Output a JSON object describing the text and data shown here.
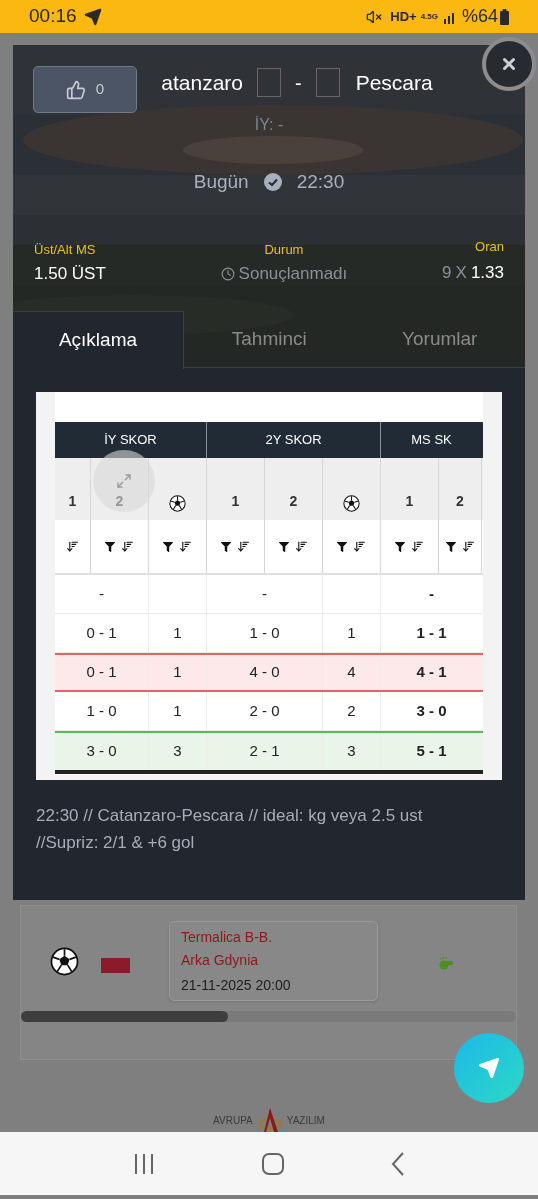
{
  "status_bar": {
    "time": "00:16",
    "network_badge": "HD+",
    "network_type": "4.5G",
    "battery": "%64"
  },
  "match": {
    "like_count": "0",
    "home_team": "atanzaro",
    "separator": "-",
    "away_team": "Pescara",
    "half_time": "İY: -",
    "day": "Bugün",
    "time": "22:30"
  },
  "market": {
    "label": "Üst/Alt MS",
    "value": "1.50 ÜST"
  },
  "status": {
    "label": "Durum",
    "value": "Sonuçlanmadı"
  },
  "odds": {
    "label": "Oran",
    "count": "9",
    "separator": "X",
    "value": "1.33"
  },
  "tabs": [
    {
      "label": "Açıklama",
      "selected": true
    },
    {
      "label": "Tahminci",
      "selected": false
    },
    {
      "label": "Yorumlar",
      "selected": false
    }
  ],
  "score_table": {
    "groups": [
      "İY SKOR",
      "2Y SKOR",
      "MS SK"
    ],
    "subheaders": [
      {
        "kind": "number",
        "label": "1"
      },
      {
        "kind": "number",
        "label": "2"
      },
      {
        "kind": "ball"
      },
      {
        "kind": "number",
        "label": "1"
      },
      {
        "kind": "number",
        "label": "2"
      },
      {
        "kind": "ball"
      },
      {
        "kind": "number",
        "label": "1"
      },
      {
        "kind": "number",
        "label": "2"
      }
    ],
    "rows": [
      {
        "kind": "plain",
        "iy": "-",
        "h2": "-",
        "ms": "-"
      },
      {
        "kind": "plain",
        "iy": "0 - 1",
        "iy_goals": "1",
        "h2": "1 - 0",
        "h2_goals": "1",
        "ms": "1 - 1"
      },
      {
        "kind": "miss",
        "iy": "0 - 1",
        "iy_goals": "1",
        "h2": "4 - 0",
        "h2_goals": "4",
        "ms": "4 - 1"
      },
      {
        "kind": "plain",
        "iy": "1 - 0",
        "iy_goals": "1",
        "h2": "2 - 0",
        "h2_goals": "2",
        "ms": "3 - 0"
      },
      {
        "kind": "hit",
        "iy": "3 - 0",
        "iy_goals": "3",
        "h2": "2 - 1",
        "h2_goals": "3",
        "ms": "5 - 1"
      }
    ]
  },
  "description": "22:30 // Catanzaro-Pescara // ideal: kg veya 2.5 ust //Supriz: 2/1 & +6 gol",
  "next_match": {
    "home": "Termalica B-B.",
    "away": "Arka Gdynia",
    "datetime": "21-11-2025 20:00"
  },
  "footer": {
    "left": "AVRUPA",
    "right": "YAZILIM"
  }
}
